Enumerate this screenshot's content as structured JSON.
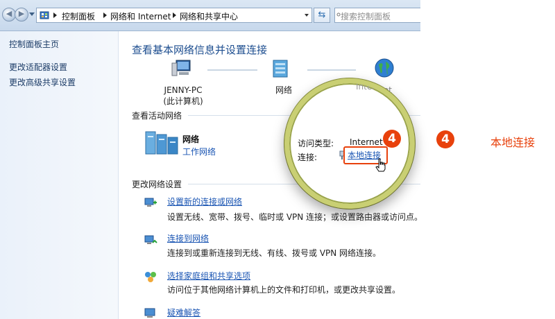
{
  "address_bar": {
    "breadcrumb": [
      "控制面板",
      "网络和 Internet",
      "网络和共享中心"
    ],
    "search_placeholder": "搜索控制面板"
  },
  "left_pane": {
    "links": [
      "控制面板主页",
      "更改适配器设置",
      "更改高级共享设置"
    ]
  },
  "main": {
    "title": "查看基本网络信息并设置连接",
    "map": {
      "computer_name": "JENNY-PC",
      "computer_sub": "(此计算机)",
      "network": "网络",
      "internet": "Internet"
    },
    "active_section": "查看活动网络",
    "active_network": {
      "name": "网络",
      "type_link": "工作网络"
    },
    "change_section": "更改网络设置",
    "tasks": [
      {
        "title": "设置新的连接或网络",
        "desc": "设置无线、宽带、拨号、临时或 VPN 连接；或设置路由器或访问点。",
        "icon": "new-connection-icon"
      },
      {
        "title": "连接到网络",
        "desc": "连接到或重新连接到无线、有线、拨号或 VPN 网络连接。",
        "icon": "connect-network-icon"
      },
      {
        "title": "选择家庭组和共享选项",
        "desc": "访问位于其他网络计算机上的文件和打印机，或更改共享设置。",
        "icon": "homegroup-icon"
      },
      {
        "title": "疑难解答",
        "desc": "",
        "icon": "troubleshoot-icon"
      }
    ]
  },
  "magnifier": {
    "access_type_label": "访问类型:",
    "access_type_value": "Internet",
    "connection_label": "连接:",
    "connection_link": "本地连接",
    "internet_partial": "Internet"
  },
  "annotation": {
    "step_number": "4",
    "callout_text": "本地连接",
    "accent_color": "#e8410c"
  }
}
